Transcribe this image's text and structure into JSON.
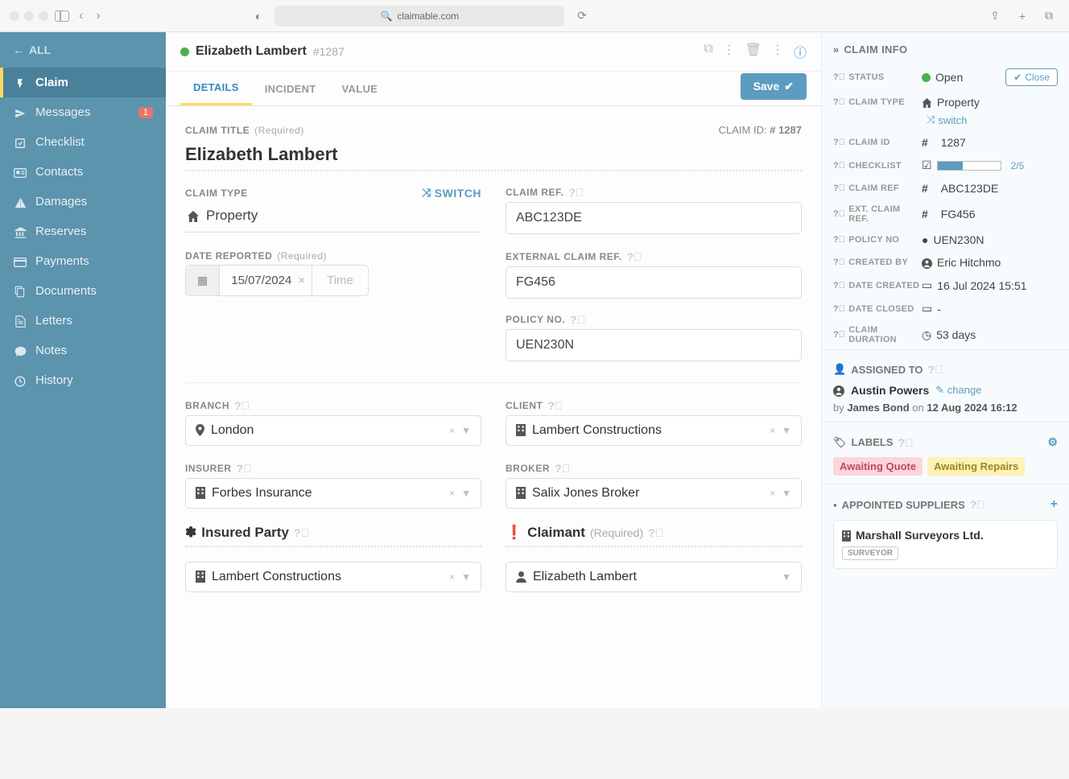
{
  "chrome": {
    "url": "claimable.com"
  },
  "sidebar": {
    "all": "ALL",
    "items": [
      {
        "label": "Claim",
        "icon": "⚡"
      },
      {
        "label": "Messages",
        "icon": "✈",
        "badge": "1"
      },
      {
        "label": "Checklist",
        "icon": "☑"
      },
      {
        "label": "Contacts",
        "icon": "🗂"
      },
      {
        "label": "Damages",
        "icon": "⚠"
      },
      {
        "label": "Reserves",
        "icon": "🏛"
      },
      {
        "label": "Payments",
        "icon": "💳"
      },
      {
        "label": "Documents",
        "icon": "📄"
      },
      {
        "label": "Letters",
        "icon": "📋"
      },
      {
        "label": "Notes",
        "icon": "💬"
      },
      {
        "label": "History",
        "icon": "🕒"
      }
    ]
  },
  "header": {
    "name": "Elizabeth Lambert",
    "id": "#1287"
  },
  "tabs": {
    "details": "DETAILS",
    "incident": "INCIDENT",
    "value": "VALUE",
    "save": "Save"
  },
  "form": {
    "title_label": "CLAIM TITLE",
    "required": "(Required)",
    "claim_id_label": "CLAIM ID:",
    "claim_id": "# 1287",
    "title_value": "Elizabeth Lambert",
    "type_label": "CLAIM TYPE",
    "switch": "switch",
    "type_value": "Property",
    "ref_label": "CLAIM REF.",
    "ref_value": "ABC123DE",
    "date_label": "DATE REPORTED",
    "date_value": "15/07/2024",
    "time_placeholder": "Time",
    "ext_ref_label": "EXTERNAL CLAIM REF.",
    "ext_ref_value": "FG456",
    "policy_label": "POLICY NO.",
    "policy_value": "UEN230N",
    "branch_label": "BRANCH",
    "branch_value": "London",
    "client_label": "CLIENT",
    "client_value": "Lambert Constructions",
    "insurer_label": "INSURER",
    "insurer_value": "Forbes Insurance",
    "broker_label": "BROKER",
    "broker_value": "Salix Jones Broker",
    "insured_label": "Insured Party",
    "insured_value": "Lambert Constructions",
    "claimant_label": "Claimant",
    "claimant_value": "Elizabeth Lambert"
  },
  "info": {
    "head": "CLAIM INFO",
    "status_label": "STATUS",
    "status_value": "Open",
    "close": "Close",
    "type_label": "CLAIM TYPE",
    "type_value": "Property",
    "switch": "switch",
    "id_label": "CLAIM ID",
    "id_value": "1287",
    "checklist_label": "CHECKLIST",
    "checklist_progress": "2/5",
    "checklist_pct": 40,
    "ref_label": "CLAIM REF",
    "ref_value": "ABC123DE",
    "ext_ref_label": "EXT. CLAIM REF.",
    "ext_ref_value": "FG456",
    "policy_label": "POLICY NO",
    "policy_value": "UEN230N",
    "created_by_label": "CREATED BY",
    "created_by_value": "Eric Hitchmo",
    "date_created_label": "DATE CREATED",
    "date_created_value": "16 Jul 2024 15:51",
    "date_closed_label": "DATE CLOSED",
    "date_closed_value": "-",
    "duration_label": "CLAIM DURATION",
    "duration_value": "53 days",
    "assigned_head": "ASSIGNED TO",
    "assigned_name": "Austin Powers",
    "change": "change",
    "audit_by": "by",
    "audit_user": "James Bond",
    "audit_on": "on",
    "audit_date": "12 Aug 2024 16:12",
    "labels_head": "LABELS",
    "label1": "Awaiting Quote",
    "label2": "Awaiting Repairs",
    "suppliers_head": "APPOINTED SUPPLIERS",
    "supplier_name": "Marshall Surveyors Ltd.",
    "supplier_tag": "SURVEYOR"
  }
}
